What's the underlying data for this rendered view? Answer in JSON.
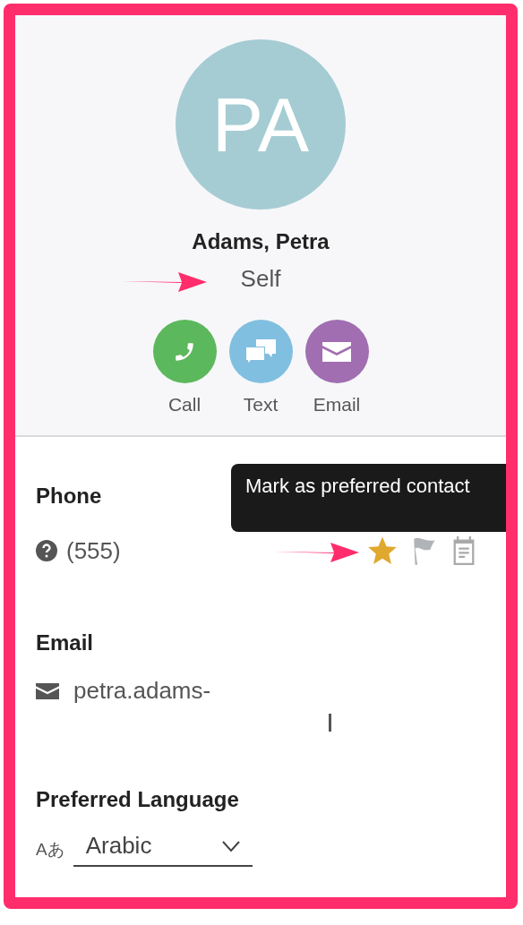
{
  "contact": {
    "initials": "PA",
    "name": "Adams, Petra",
    "relationship": "Self"
  },
  "actions": [
    {
      "kind": "call",
      "label": "Call",
      "color": "#5cb85c"
    },
    {
      "kind": "text",
      "label": "Text",
      "color": "#81bfe0"
    },
    {
      "kind": "email",
      "label": "Email",
      "color": "#a06eb1"
    }
  ],
  "phone": {
    "label": "Phone",
    "value": "(555)",
    "preferred": true,
    "flagged": false,
    "tooltip": "Mark as preferred contact"
  },
  "email": {
    "label": "Email",
    "value": "petra.adams-"
  },
  "language": {
    "label": "Preferred Language",
    "icon_text": "Aあ",
    "value": "Arabic"
  }
}
